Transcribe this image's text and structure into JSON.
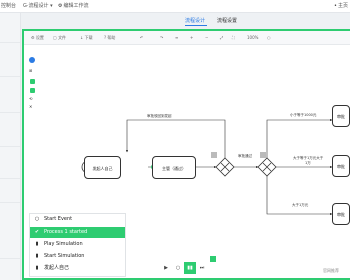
{
  "topbar": {
    "items": [
      {
        "label": "控制台"
      },
      {
        "label": "流程设计",
        "prefix": "G·",
        "caret": "▾"
      },
      {
        "label": "编辑工作流"
      }
    ],
    "right": {
      "label": "主页"
    }
  },
  "editor_tabs": [
    {
      "label": "流程设计",
      "active": true
    },
    {
      "label": "流程设置",
      "active": false
    }
  ],
  "toolbar": {
    "labels": [
      "设置",
      "文件",
      "下载",
      "帮助"
    ],
    "zoom": "100%",
    "icons": [
      "undo-icon",
      "redo-icon",
      "align-icon",
      "zoom-in-icon",
      "zoom-out-icon",
      "fit-icon",
      "fullscreen-icon"
    ]
  },
  "palette": {
    "colors": {
      "blue": "#2b7be4",
      "green": "#2ecc71",
      "dark": "#333333"
    }
  },
  "diagram": {
    "tasks": {
      "initiator": "发起人自己",
      "supervisor": "主管（通过）",
      "approve_1": "审批",
      "approve_2": "审批",
      "approve_3": "审批"
    },
    "flows": {
      "reject_back": "审批驳回到发起",
      "passed": "审批通过",
      "amount_small": "小于等于1000元",
      "amount_mid": "大于等于1万元大于",
      "amount_mid_sub": "1万",
      "amount_large": "大于1万元"
    }
  },
  "simulation": {
    "rows": [
      {
        "icon": "○",
        "label": "Start Event",
        "active": false
      },
      {
        "icon": "✔",
        "label": "Process 1 started",
        "active": true
      },
      {
        "icon": "▮",
        "label": "Play Simulation",
        "active": false
      },
      {
        "icon": "▮",
        "label": "Start Simulation",
        "active": false
      },
      {
        "icon": "▮",
        "label": "发起人自己",
        "active": false
      }
    ]
  },
  "bottom_controls": {
    "labels": [
      "▶",
      "○",
      "⏭"
    ]
  },
  "watermark": "官网推荐"
}
